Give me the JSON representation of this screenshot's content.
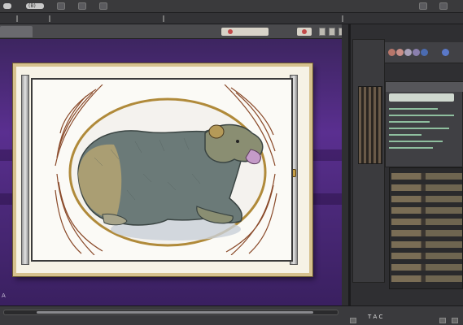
{
  "menubar": {
    "items": [
      "",
      "(B)"
    ],
    "icons": [
      "file-icon",
      "edit-icon",
      "view-icon",
      "window-icon",
      "help-icon"
    ]
  },
  "tabs": {
    "active_label": "",
    "field_pill": "",
    "icons": [
      "record-icon",
      "panel-icon",
      "panel-icon",
      "close-icon"
    ]
  },
  "canvas": {
    "background": "#5a2f90",
    "side_marker": "A"
  },
  "artwork": {
    "subject": "bear",
    "frame_color": "#d6c18e",
    "ring_color": "#b08a3a"
  },
  "panels": {
    "swatches": [
      "#b7766a",
      "#c98f88",
      "#a9a1b9",
      "#8a7fae",
      "#4b6bb0",
      "#5a78c8"
    ],
    "props_title": "",
    "layers_caption": ""
  },
  "status": {
    "text": "T A C",
    "icons": [
      "info-icon",
      "settings-icon",
      "close-icon"
    ]
  }
}
